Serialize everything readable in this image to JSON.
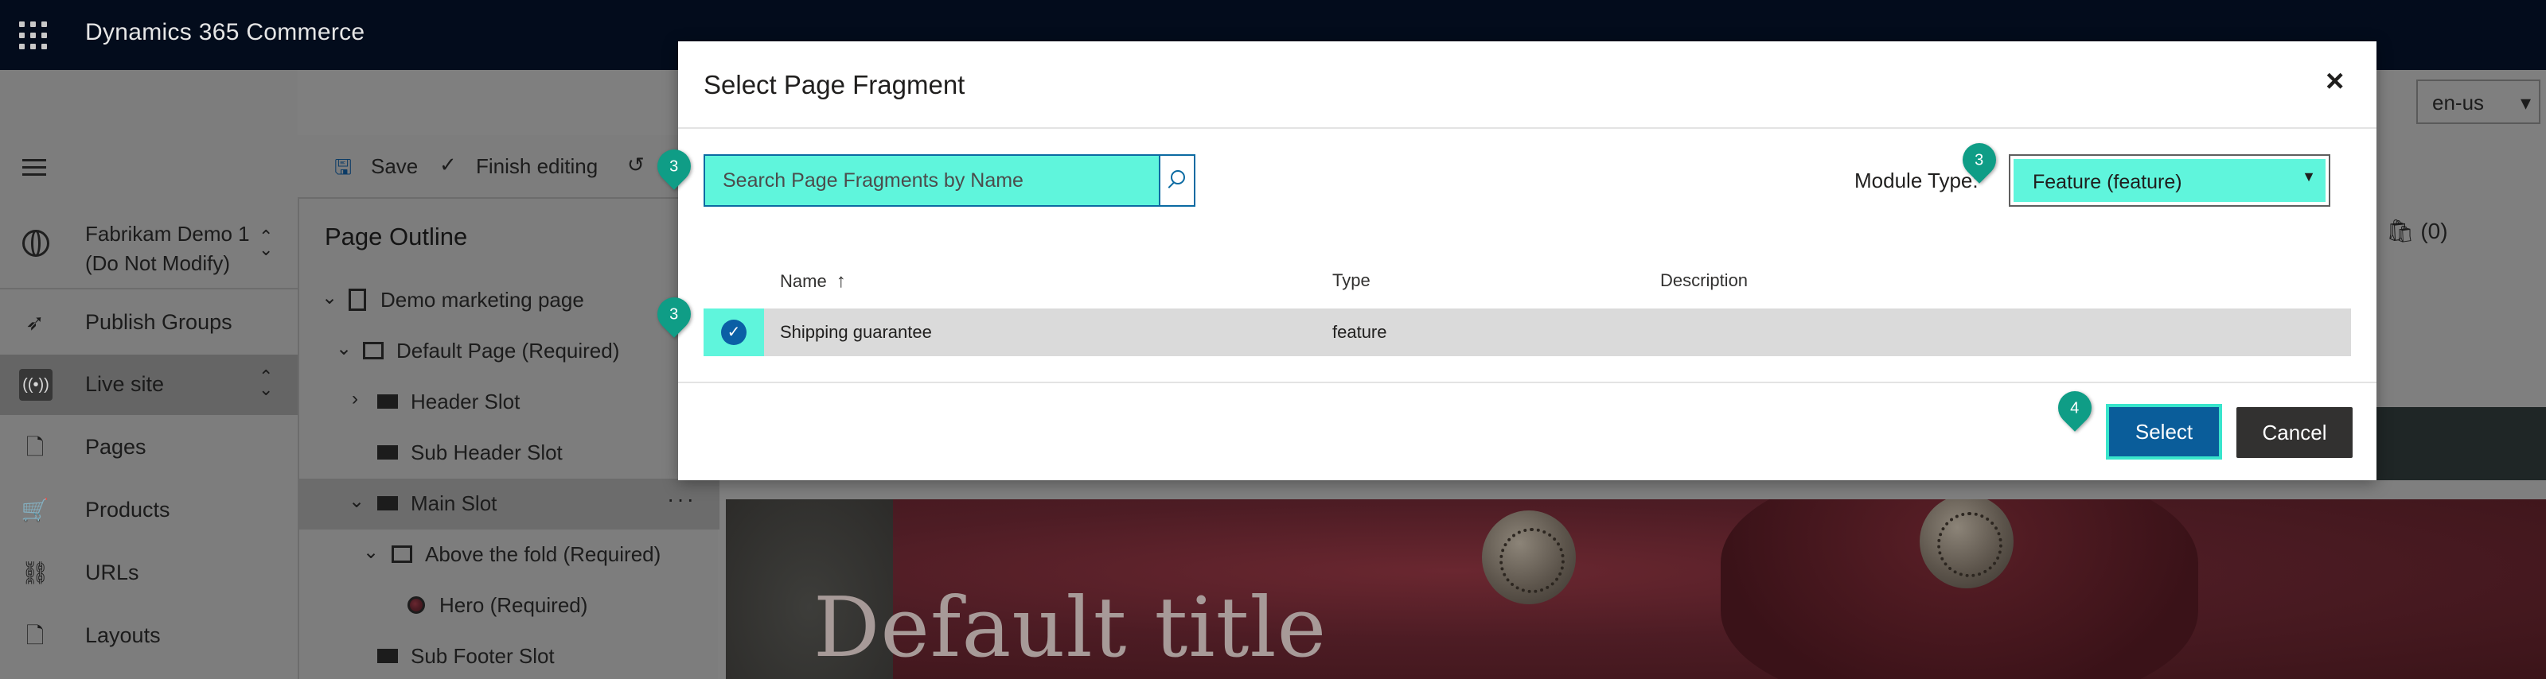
{
  "app": {
    "title": "Dynamics 365 Commerce"
  },
  "nav": {
    "site": "Fabrikam Demo 1 (Do Not Modify)",
    "items": [
      {
        "label": "Publish Groups",
        "icon": "rocket-icon"
      },
      {
        "label": "Live site",
        "icon": "broadcast-icon"
      },
      {
        "label": "Pages",
        "icon": "page-icon"
      },
      {
        "label": "Products",
        "icon": "cart-icon"
      },
      {
        "label": "URLs",
        "icon": "link-icon"
      },
      {
        "label": "Layouts",
        "icon": "layout-icon"
      }
    ]
  },
  "toolbar": {
    "save_label": "Save",
    "finish_label": "Finish editing"
  },
  "outline": {
    "title": "Page Outline",
    "rows": [
      {
        "label": "Demo marketing page",
        "twisty": "v"
      },
      {
        "label": "Default Page (Required)",
        "twisty": "v"
      },
      {
        "label": "Header Slot",
        "twisty": ">"
      },
      {
        "label": "Sub Header Slot",
        "twisty": ""
      },
      {
        "label": "Main Slot",
        "twisty": "v"
      },
      {
        "label": "Above the fold (Required)",
        "twisty": "v"
      },
      {
        "label": "Hero (Required)",
        "twisty": ""
      },
      {
        "label": "Sub Footer Slot",
        "twisty": ""
      }
    ],
    "more": "···"
  },
  "background": {
    "locale": "en-us",
    "cart": "(0)",
    "hero_title": "Default title"
  },
  "modal": {
    "title": "Select Page Fragment",
    "close": "×",
    "search_placeholder": "Search Page Fragments by Name",
    "module_type_label": "Module Type:",
    "module_type_value": "Feature (feature)",
    "columns": {
      "name": "Name",
      "type": "Type",
      "description": "Description",
      "sort_arrow": "↑"
    },
    "rows": [
      {
        "name": "Shipping guarantee",
        "type": "feature",
        "description": ""
      }
    ],
    "select_label": "Select",
    "cancel_label": "Cancel"
  },
  "callouts": [
    "3",
    "3",
    "3",
    "4"
  ],
  "colors": {
    "highlight": "#5ff5dc",
    "primary": "#0a5d9a",
    "callout": "#0f9d86"
  }
}
